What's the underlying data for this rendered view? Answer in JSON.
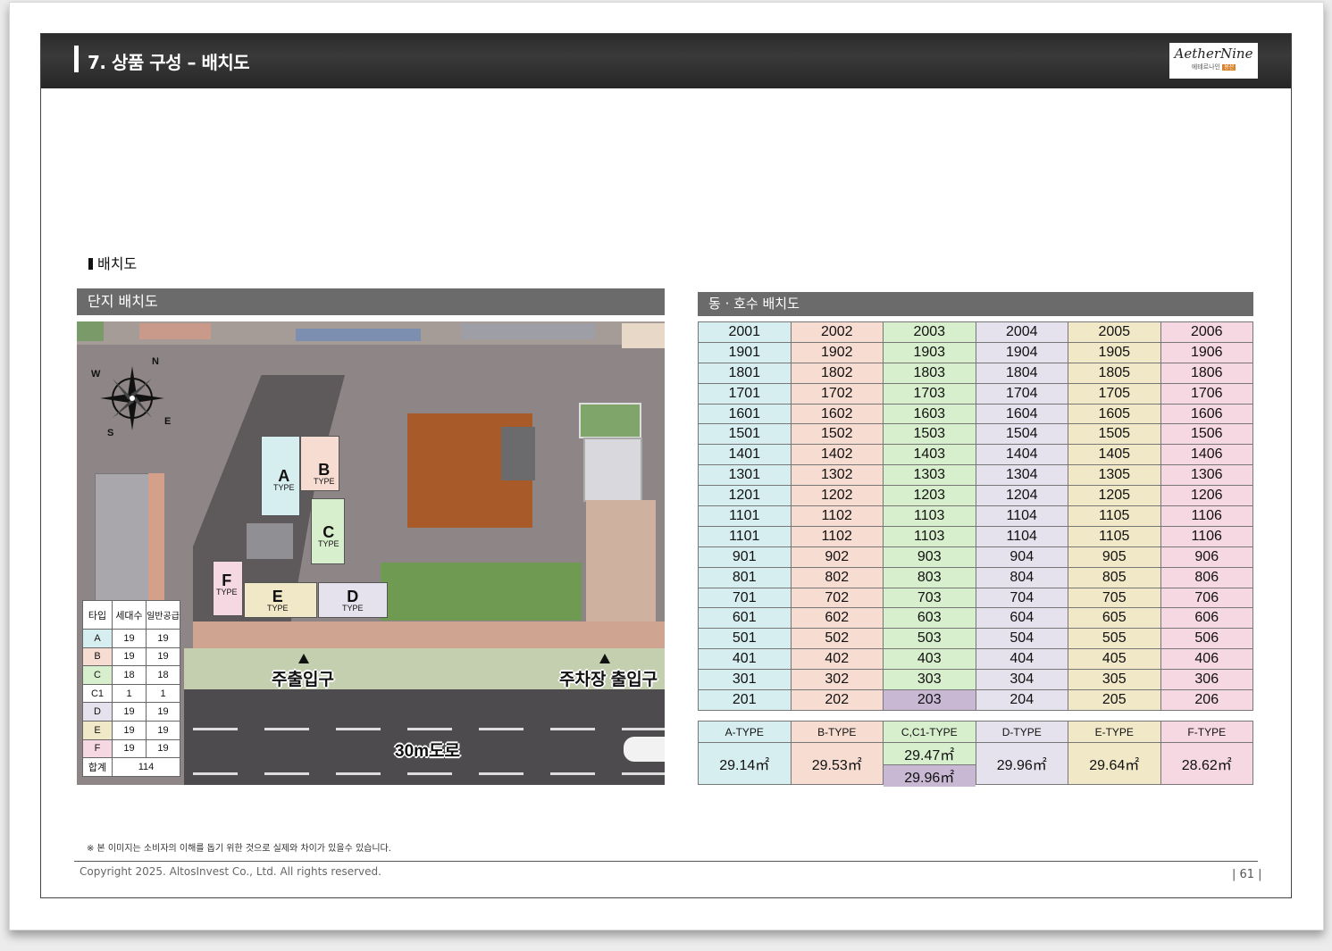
{
  "header": {
    "title": "7. 상품 구성 – 배치도"
  },
  "logo": {
    "name": "AetherNine",
    "sub": "에테르나인",
    "tag": "용산"
  },
  "section": {
    "label": "배치도"
  },
  "site_panel": {
    "title": "단지 배치도",
    "types": [
      {
        "big": "A",
        "small": "TYPE"
      },
      {
        "big": "B",
        "small": "TYPE"
      },
      {
        "big": "C",
        "small": "TYPE"
      },
      {
        "big": "F",
        "small": "TYPE"
      },
      {
        "big": "E",
        "small": "TYPE"
      },
      {
        "big": "D",
        "small": "TYPE"
      }
    ],
    "compass": {
      "n": "N",
      "e": "E",
      "s": "S",
      "w": "W"
    },
    "main_entrance": "주출입구",
    "parking_entrance": "주차장 출입구",
    "road": "30m도로",
    "legend": {
      "headers": [
        "타입",
        "세대수",
        "일반공급"
      ],
      "rows": [
        [
          "A",
          "19",
          "19"
        ],
        [
          "B",
          "19",
          "19"
        ],
        [
          "C",
          "18",
          "18"
        ],
        [
          "C1",
          "1",
          "1"
        ],
        [
          "D",
          "19",
          "19"
        ],
        [
          "E",
          "19",
          "19"
        ],
        [
          "F",
          "19",
          "19"
        ]
      ],
      "total_label": "합계",
      "total_value": "114",
      "row_colors": [
        "#d7eef1",
        "#f7dcd2",
        "#d8efce",
        "#ffffff",
        "#e6e2ed",
        "#f1e8c8",
        "#f6d8e3"
      ]
    }
  },
  "unit_panel": {
    "title": "동 · 호수 배치도",
    "rows": [
      [
        "2001",
        "2002",
        "2003",
        "2004",
        "2005",
        "2006"
      ],
      [
        "1901",
        "1902",
        "1903",
        "1904",
        "1905",
        "1906"
      ],
      [
        "1801",
        "1802",
        "1803",
        "1804",
        "1805",
        "1806"
      ],
      [
        "1701",
        "1702",
        "1703",
        "1704",
        "1705",
        "1706"
      ],
      [
        "1601",
        "1602",
        "1603",
        "1604",
        "1605",
        "1606"
      ],
      [
        "1501",
        "1502",
        "1503",
        "1504",
        "1505",
        "1506"
      ],
      [
        "1401",
        "1402",
        "1403",
        "1404",
        "1405",
        "1406"
      ],
      [
        "1301",
        "1302",
        "1303",
        "1304",
        "1305",
        "1306"
      ],
      [
        "1201",
        "1202",
        "1203",
        "1204",
        "1205",
        "1206"
      ],
      [
        "1101",
        "1102",
        "1103",
        "1104",
        "1105",
        "1106"
      ],
      [
        "1101",
        "1102",
        "1103",
        "1104",
        "1105",
        "1106"
      ],
      [
        "901",
        "902",
        "903",
        "904",
        "905",
        "906"
      ],
      [
        "801",
        "802",
        "803",
        "804",
        "805",
        "806"
      ],
      [
        "701",
        "702",
        "703",
        "704",
        "705",
        "706"
      ],
      [
        "601",
        "602",
        "603",
        "604",
        "605",
        "606"
      ],
      [
        "501",
        "502",
        "503",
        "504",
        "505",
        "506"
      ],
      [
        "401",
        "402",
        "403",
        "404",
        "405",
        "406"
      ],
      [
        "301",
        "302",
        "303",
        "304",
        "305",
        "306"
      ],
      [
        "201",
        "202",
        "203",
        "204",
        "205",
        "206"
      ]
    ],
    "column_colors": [
      "#d7eef1",
      "#f7dcd2",
      "#d8efce",
      "#e6e2ed",
      "#f1e8c8",
      "#f6d8e3"
    ],
    "highlight": {
      "unit": "203",
      "color": "#c8b8d4"
    },
    "type_headers": [
      "A-TYPE",
      "B-TYPE",
      "C,C1-TYPE",
      "D-TYPE",
      "E-TYPE",
      "F-TYPE"
    ],
    "type_areas": {
      "a": "29.14㎡",
      "b": "29.53㎡",
      "c": "29.47㎡",
      "c1": "29.96㎡",
      "d": "29.96㎡",
      "e": "29.64㎡",
      "f": "28.62㎡"
    }
  },
  "footer": {
    "note": "※ 본 이미지는 소비자의 이해를 돕기 위한 것으로 실제와 차이가 있을수 있습니다.",
    "copyright": "Copyright 2025. AltosInvest Co., Ltd. All rights reserved.",
    "page": "| 61 |"
  }
}
